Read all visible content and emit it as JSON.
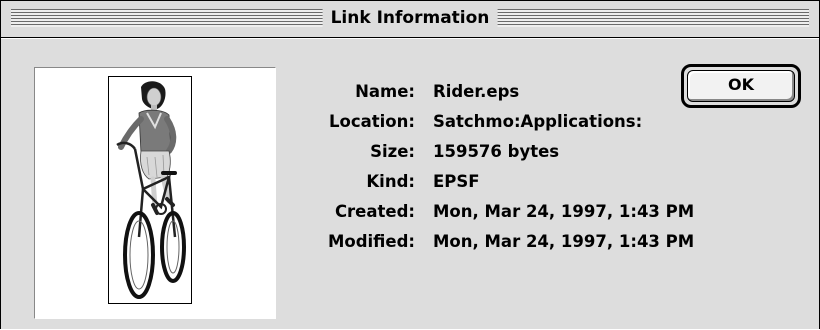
{
  "window": {
    "title": "Link Information"
  },
  "info": {
    "labels": [
      "Name:",
      "Location:",
      "Size:",
      "Kind:",
      "Created:",
      "Modified:"
    ],
    "values": [
      "Rider.eps",
      "Satchmo:Applications:",
      "159576 bytes",
      "EPSF",
      "Mon, Mar 24, 1997, 1:43 PM",
      "Mon, Mar 24, 1997, 1:43 PM"
    ]
  },
  "buttons": {
    "ok_label": "OK"
  },
  "preview": {
    "icon": "image-preview-bicycle-rider"
  }
}
